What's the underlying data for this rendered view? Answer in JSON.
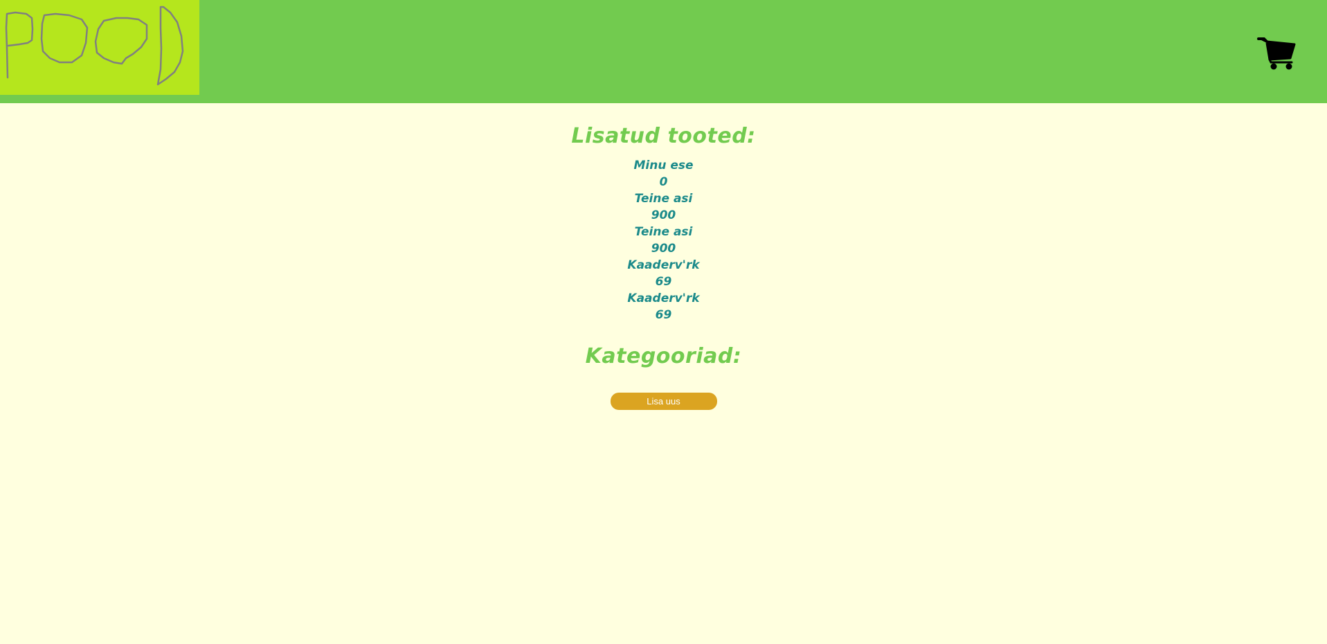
{
  "header": {
    "logo_text": "POOD",
    "icons": {
      "logo": "pood-logo",
      "cart": "cart-icon"
    },
    "colors": {
      "header_bg": "#72cb4f",
      "logo_bg": "#b5e61d",
      "logo_stroke": "#808080"
    }
  },
  "main": {
    "products_title": "Lisatud tooted:",
    "products": [
      {
        "name": "Minu ese",
        "price": "0"
      },
      {
        "name": "Teine asi",
        "price": "900"
      },
      {
        "name": "Teine asi",
        "price": "900"
      },
      {
        "name": "Kaaderv'rk",
        "price": "69"
      },
      {
        "name": "Kaaderv'rk",
        "price": "69"
      }
    ],
    "categories_title": "Kategooriad:",
    "add_button_label": "Lisa uus",
    "colors": {
      "page_bg": "#ffffdf",
      "title": "#72cb4f",
      "product_text": "#1b8a8a",
      "button_bg": "#dba421",
      "button_text": "#ffffff"
    }
  }
}
